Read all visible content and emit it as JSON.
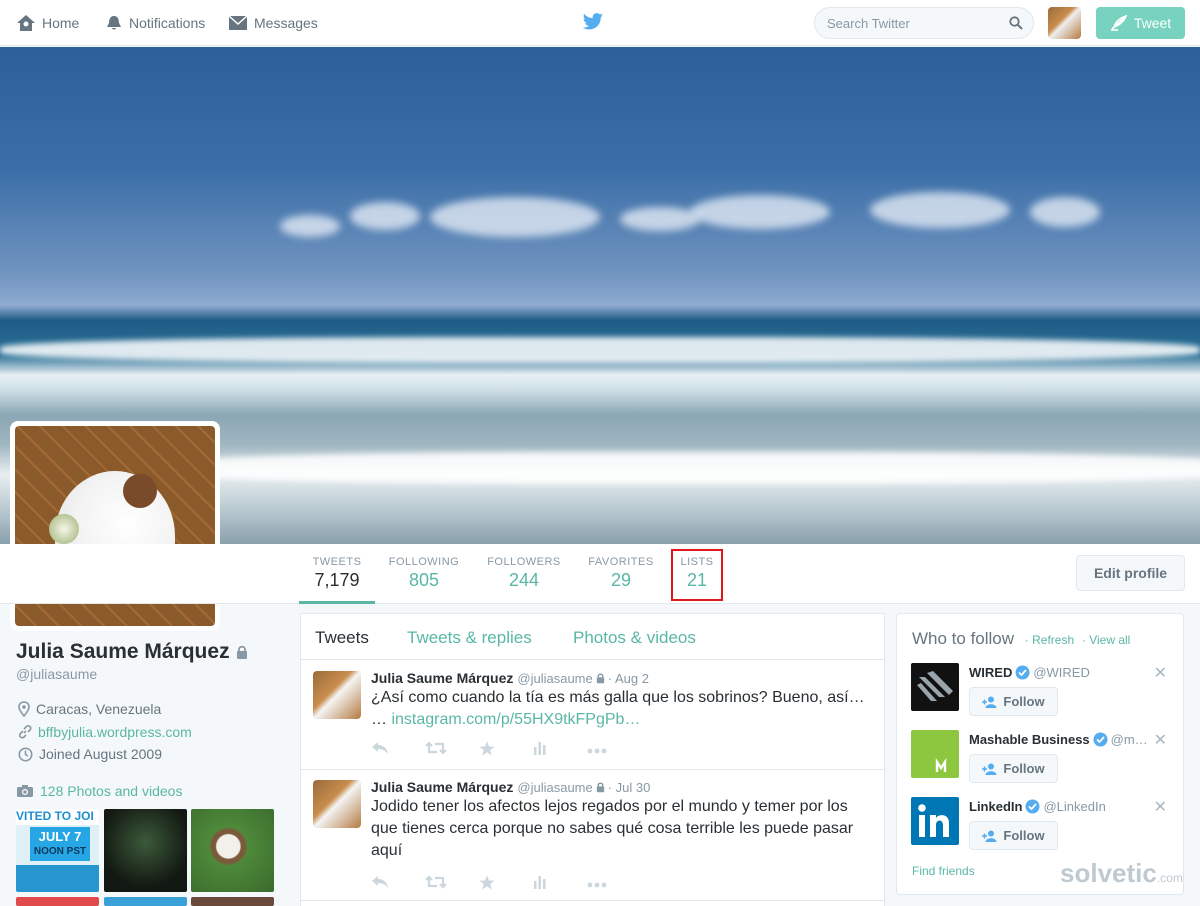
{
  "nav": {
    "home": "Home",
    "notifications": "Notifications",
    "messages": "Messages",
    "search_placeholder": "Search Twitter",
    "tweet_button": "Tweet"
  },
  "profile": {
    "name": "Julia Saume Márquez",
    "handle": "@juliasaume",
    "location": "Caracas, Venezuela",
    "website": "bffbyjulia.wordpress.com",
    "joined": "Joined August 2009",
    "photos_link": "128 Photos and videos",
    "thumb_text": {
      "invite": "VITED TO JOI",
      "date": "JULY 7",
      "time": "NOON PST"
    }
  },
  "stats": {
    "tweets_label": "TWEETS",
    "tweets_value": "7,179",
    "following_label": "FOLLOWING",
    "following_value": "805",
    "followers_label": "FOLLOWERS",
    "followers_value": "244",
    "favorites_label": "FAVORITES",
    "favorites_value": "29",
    "lists_label": "LISTS",
    "lists_value": "21",
    "edit_profile": "Edit profile"
  },
  "timeline": {
    "tabs": [
      "Tweets",
      "Tweets & replies",
      "Photos & videos"
    ],
    "tweets": [
      {
        "name": "Julia Saume Márquez",
        "handle": "@juliasaume",
        "date": "· Aug 2",
        "text": "¿Así como cuando la tía es más galla que los sobrinos? Bueno, así…",
        "text2_prefix": "…",
        "link": "instagram.com/p/55HX9tkFPgPb…"
      },
      {
        "name": "Julia Saume Márquez",
        "handle": "@juliasaume",
        "date": "· Jul 30",
        "text": "Jodido tener los afectos lejos regados por el mundo y temer por los que tienes cerca porque no sabes qué cosa terrible les puede pasar aquí"
      }
    ]
  },
  "who_to_follow": {
    "title": "Who to follow",
    "refresh": "· Refresh",
    "view_all": "· View all",
    "items": [
      {
        "name": "WIRED",
        "handle": "@WIRED",
        "follow": "Follow"
      },
      {
        "name": "Mashable Business",
        "handle": "@m…",
        "follow": "Follow"
      },
      {
        "name": "LinkedIn",
        "handle": "@LinkedIn",
        "follow": "Follow"
      }
    ],
    "find_friends": "Find friends"
  },
  "watermark": {
    "main": "solvetic",
    "sub": ".com"
  },
  "colors": {
    "accent": "#5ab7a5",
    "tweet_button": "#78d2c0",
    "highlight_box": "#e0181d"
  }
}
